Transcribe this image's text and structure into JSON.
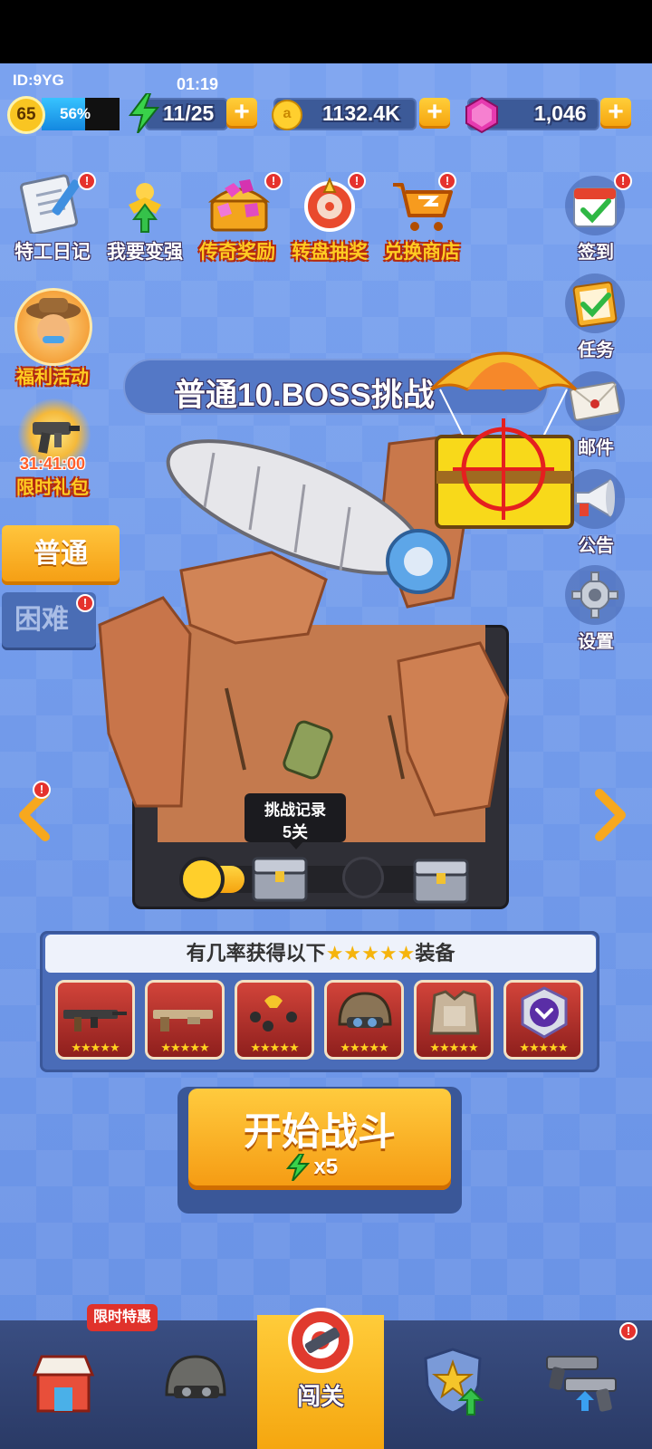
{
  "status": {
    "player_id": "ID:9YG",
    "timer": "01:19",
    "level": "65",
    "exp_percent_label": "56%",
    "exp_fraction": 0.56,
    "energy": "11/25",
    "coins": "1132.4K",
    "gems": "1,046"
  },
  "top_menu": [
    {
      "label": "特工日记",
      "icon": "notebook-icon"
    },
    {
      "label": "我要变强",
      "icon": "power-up-icon"
    },
    {
      "label": "传奇奖励",
      "icon": "gem-chest-icon"
    },
    {
      "label": "转盘抽奖",
      "icon": "wheel-icon"
    },
    {
      "label": "兑换商店",
      "icon": "cart-icon"
    }
  ],
  "right_menu": [
    {
      "label": "签到",
      "icon": "calendar-check-icon"
    },
    {
      "label": "任务",
      "icon": "task-check-icon"
    },
    {
      "label": "邮件",
      "icon": "mail-icon"
    },
    {
      "label": "公告",
      "icon": "megaphone-icon"
    },
    {
      "label": "设置",
      "icon": "gear-icon"
    }
  ],
  "left_menu": {
    "welfare_label": "福利活动",
    "pack_timer": "31:41:00",
    "pack_label": "限时礼包"
  },
  "difficulty": {
    "normal": "普通",
    "hard": "困难"
  },
  "stage": {
    "title": "普通10.BOSS挑战",
    "record_label": "挑战记录",
    "record_value": "5关",
    "progress_fraction": 0.2
  },
  "rewards": {
    "header_prefix": "有几率获得以下",
    "header_stars": "★★★★★",
    "header_suffix": "装备",
    "stars": "★★★★★",
    "items": [
      "rifle-icon",
      "shotgun-icon",
      "drone-icon",
      "helmet-icon",
      "armor-icon",
      "badge-icon"
    ]
  },
  "start_button": {
    "label": "开始战斗",
    "cost": "x5"
  },
  "bottom_nav": {
    "shop_badge": "限时特惠",
    "battle_label": "闯关"
  },
  "colors": {
    "background": "#6d96e8",
    "accent_orange": "#f7a11a",
    "badge_red": "#e5322d",
    "exp_blue": "#1ea7f3"
  }
}
